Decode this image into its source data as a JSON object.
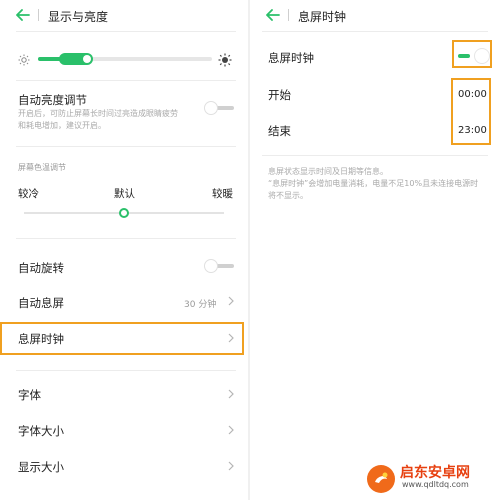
{
  "colors": {
    "accent": "#2ac06a",
    "highlight": "#f0a020"
  },
  "left": {
    "title": "显示与亮度",
    "brightness": {
      "level_fraction": 0.22
    },
    "auto_brightness": {
      "label": "自动亮度调节",
      "subtitle_line1": "开启后，可防止屏幕长时间过亮造成眼睛疲劳",
      "subtitle_line2": "和耗电增加，建议开启。",
      "enabled": false
    },
    "color_temp": {
      "section_label": "屏幕色温调节",
      "cold": "较冷",
      "default": "默认",
      "warm": "较暖",
      "level_fraction": 0.5
    },
    "auto_rotate": {
      "label": "自动旋转",
      "enabled": false
    },
    "auto_sleep": {
      "label": "自动息屏",
      "value": "30 分钟"
    },
    "clock": {
      "label": "息屏时钟"
    },
    "font": {
      "label": "字体"
    },
    "font_size": {
      "label": "字体大小"
    },
    "display_size": {
      "label": "显示大小"
    }
  },
  "right": {
    "title": "息屏时钟",
    "clock_toggle": {
      "label": "息屏时钟",
      "enabled": true
    },
    "start": {
      "label": "开始",
      "value": "00:00"
    },
    "end": {
      "label": "结束",
      "value": "23:00"
    },
    "note_line1": "息屏状态显示时间及日期等信息。",
    "note_line2": "“息屏时钟”会增加电量消耗，电量不足10%且未连接电源时",
    "note_line3": "将不显示。"
  },
  "watermark": {
    "name": "启东安卓网",
    "url": "www.qdltdq.com"
  }
}
